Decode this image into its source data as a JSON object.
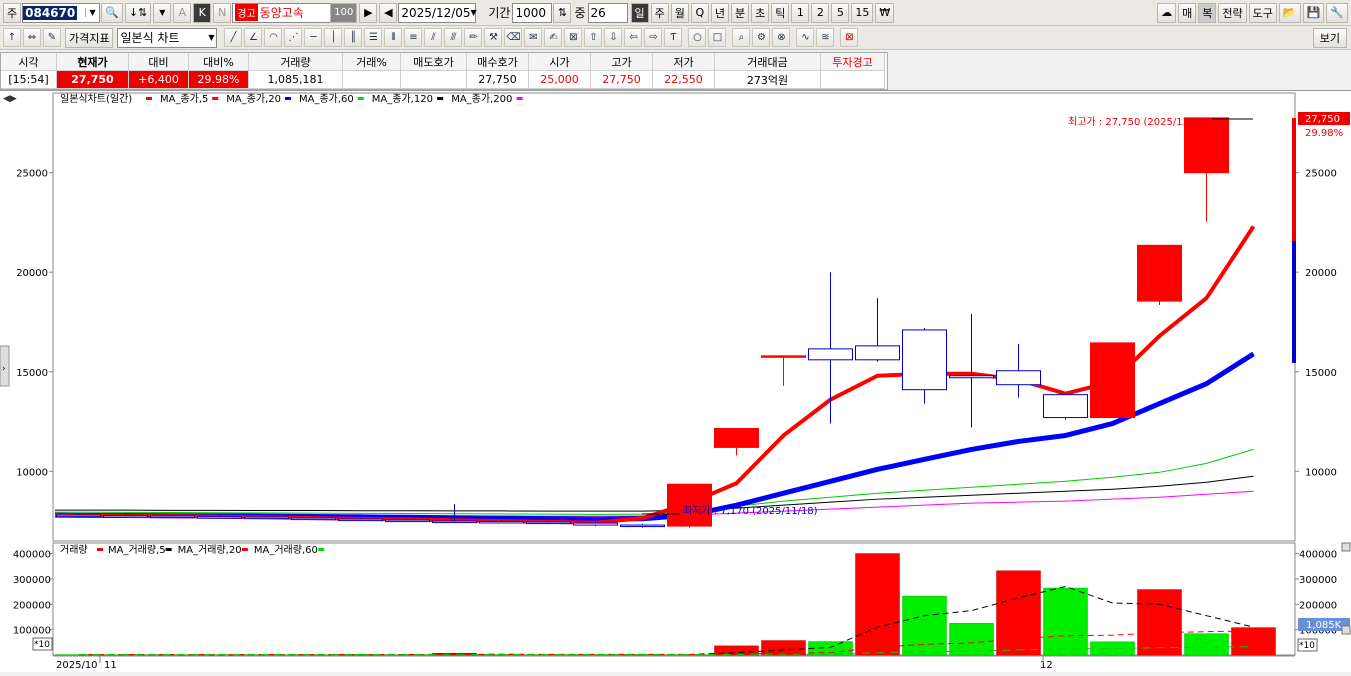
{
  "toolbar1": {
    "market": "주",
    "code": "084670",
    "warning_badge": "경고",
    "stock_name": "동양고속",
    "zoom": "100",
    "date": "2025/12/05",
    "period_label": "기간",
    "period_value": "1000",
    "count_label": "중",
    "count_value": "26",
    "intervals": [
      "일",
      "주",
      "월",
      "Q",
      "년",
      "분",
      "초",
      "틱",
      "1",
      "2",
      "5",
      "15",
      "₩"
    ],
    "right_buttons": [
      "매",
      "복",
      "전략",
      "도구"
    ]
  },
  "toolbar2": {
    "indicator_button": "가격지표",
    "chart_type": "일본식 차트",
    "view_button": "보기"
  },
  "quote": {
    "headers": [
      "시각",
      "현재가",
      "대비",
      "대비%",
      "거래량",
      "거래%",
      "매도호가",
      "매수호가",
      "시가",
      "고가",
      "저가",
      "거래대금",
      "투자경고"
    ],
    "values": [
      "[15:54]",
      "27,750",
      "+6,400",
      "29.98%",
      "1,085,181",
      "",
      "",
      "27,750",
      "25,000",
      "27,750",
      "22,550",
      "273억원",
      ""
    ]
  },
  "price_panel": {
    "legend_title": "일본식차트(일간)",
    "legend_items": [
      "MA_종가,5",
      "MA_종가,20",
      "MA_종가,60",
      "MA_종가,120",
      "MA_종가,200"
    ],
    "legend_colors": [
      "#ff0000",
      "#ff0000",
      "#0000ff",
      "#00dd00",
      "#000000",
      "#ff00ff"
    ],
    "high_annotation": "최고가 : 27,750 (2025/12/05)",
    "low_annotation": "최저가 : 7,170 (2025/11/18)",
    "last_price_tag": "27,750",
    "last_pct_tag": "29.98%"
  },
  "volume_panel": {
    "legend_title": "거래량",
    "legend_items": [
      "MA_거래량,5",
      "MA_거래량,20",
      "MA_거래량,60"
    ],
    "legend_colors": [
      "#ff0000",
      "#000000",
      "#ff0000",
      "#00dd00"
    ],
    "last_volume_tag": "1,085K",
    "scale_tag": "*10"
  },
  "x_axis": {
    "labels": [
      "2025/10",
      "11",
      "12"
    ]
  },
  "chart_data": [
    {
      "type": "candlestick",
      "title": "일본식차트(일간)",
      "ylim": [
        6500,
        29000
      ],
      "y_ticks": [
        10000,
        15000,
        20000,
        25000
      ],
      "candles": [
        {
          "o": 7800,
          "h": 7850,
          "l": 7750,
          "c": 7800,
          "up": false
        },
        {
          "o": 7780,
          "h": 7850,
          "l": 7700,
          "c": 7750,
          "up": false
        },
        {
          "o": 7750,
          "h": 7800,
          "l": 7700,
          "c": 7720,
          "up": false
        },
        {
          "o": 7720,
          "h": 7800,
          "l": 7650,
          "c": 7700,
          "up": false
        },
        {
          "o": 7700,
          "h": 7750,
          "l": 7620,
          "c": 7650,
          "up": false
        },
        {
          "o": 7650,
          "h": 7700,
          "l": 7580,
          "c": 7600,
          "up": false
        },
        {
          "o": 7600,
          "h": 7650,
          "l": 7520,
          "c": 7550,
          "up": false
        },
        {
          "o": 7550,
          "h": 7600,
          "l": 7480,
          "c": 7500,
          "up": false
        },
        {
          "o": 7500,
          "h": 8350,
          "l": 7450,
          "c": 7480,
          "up": false
        },
        {
          "o": 7480,
          "h": 7550,
          "l": 7400,
          "c": 7450,
          "up": false
        },
        {
          "o": 7450,
          "h": 7500,
          "l": 7350,
          "c": 7400,
          "up": false
        },
        {
          "o": 7400,
          "h": 7450,
          "l": 7250,
          "c": 7300,
          "up": false
        },
        {
          "o": 7300,
          "h": 7350,
          "l": 7170,
          "c": 7250,
          "up": false
        },
        {
          "o": 7250,
          "h": 9350,
          "l": 7170,
          "c": 9350,
          "up": true
        },
        {
          "o": 11200,
          "h": 12150,
          "l": 10800,
          "c": 12150,
          "up": true
        },
        {
          "o": 15750,
          "h": 15800,
          "l": 14300,
          "c": 15800,
          "up": true
        },
        {
          "o": 16150,
          "h": 20000,
          "l": 12400,
          "c": 15600,
          "up": false
        },
        {
          "o": 16300,
          "h": 18700,
          "l": 15500,
          "c": 15600,
          "up": false
        },
        {
          "o": 17100,
          "h": 17200,
          "l": 13400,
          "c": 14100,
          "up": false
        },
        {
          "o": 14800,
          "h": 17900,
          "l": 12200,
          "c": 14700,
          "up": false
        },
        {
          "o": 15050,
          "h": 16400,
          "l": 13700,
          "c": 14350,
          "up": false
        },
        {
          "o": 13850,
          "h": 13850,
          "l": 12600,
          "c": 12700,
          "up": false
        },
        {
          "o": 12700,
          "h": 16450,
          "l": 12700,
          "c": 16450,
          "up": true
        },
        {
          "o": 18550,
          "h": 21350,
          "l": 18350,
          "c": 21350,
          "up": true
        },
        {
          "o": 25000,
          "h": 27750,
          "l": 22550,
          "c": 27750,
          "up": true
        }
      ],
      "series": [
        {
          "name": "MA_종가,5",
          "color": "#ff0000",
          "values": [
            7800,
            7780,
            7760,
            7740,
            7720,
            7690,
            7650,
            7610,
            7580,
            7540,
            7500,
            7460,
            7420,
            7650,
            8400,
            9400,
            11800,
            13600,
            14800,
            14900,
            14900,
            14600,
            13900,
            14500,
            16800,
            18700,
            22300
          ]
        },
        {
          "name": "MA_종가,20",
          "color": "#0000ff",
          "values": [
            7800,
            7790,
            7780,
            7770,
            7760,
            7750,
            7730,
            7710,
            7690,
            7670,
            7650,
            7620,
            7600,
            7620,
            7800,
            8300,
            8900,
            9500,
            10100,
            10600,
            11100,
            11500,
            11800,
            12400,
            13400,
            14400,
            15900
          ]
        },
        {
          "name": "MA_종가,60",
          "color": "#00cc00",
          "values": [
            7950,
            7950,
            7940,
            7930,
            7920,
            7910,
            7900,
            7890,
            7880,
            7870,
            7860,
            7850,
            7840,
            7850,
            8000,
            8250,
            8500,
            8700,
            8900,
            9050,
            9200,
            9350,
            9500,
            9700,
            9950,
            10400,
            11100
          ]
        },
        {
          "name": "MA_종가,120",
          "color": "#000000",
          "values": [
            8050,
            8050,
            8050,
            8040,
            8040,
            8030,
            8030,
            8020,
            8020,
            8010,
            8010,
            8000,
            8000,
            8000,
            8050,
            8150,
            8300,
            8450,
            8600,
            8700,
            8800,
            8900,
            9000,
            9100,
            9250,
            9450,
            9750
          ]
        },
        {
          "name": "MA_종가,200",
          "color": "#ff00ff",
          "values": [
            7750,
            7750,
            7750,
            7750,
            7750,
            7750,
            7750,
            7750,
            7750,
            7750,
            7750,
            7750,
            7750,
            7760,
            7800,
            7900,
            8000,
            8100,
            8200,
            8300,
            8400,
            8450,
            8500,
            8600,
            8700,
            8850,
            9000
          ]
        }
      ]
    },
    {
      "type": "bar",
      "title": "거래량",
      "ylim": [
        0,
        410000
      ],
      "y_ticks": [
        100000,
        200000,
        300000,
        400000
      ],
      "values": [
        1500,
        1200,
        1300,
        1000,
        1200,
        1400,
        2500,
        1500,
        7000,
        2000,
        1500,
        2000,
        2500,
        1800,
        36000,
        57000,
        53000,
        400000,
        232000,
        125000,
        332000,
        264000,
        52000,
        258000,
        84000,
        108000
      ],
      "up": [
        false,
        false,
        false,
        false,
        false,
        false,
        false,
        false,
        true,
        false,
        false,
        false,
        false,
        false,
        true,
        true,
        false,
        true,
        false,
        false,
        true,
        false,
        false,
        true,
        false,
        true
      ],
      "series": [
        {
          "name": "MA_거래량,5",
          "color": "#000000",
          "values": [
            1500,
            1400,
            1300,
            1200,
            1300,
            1300,
            1500,
            2000,
            2500,
            2800,
            2600,
            2600,
            2500,
            2200,
            9000,
            20000,
            30000,
            110000,
            155000,
            175000,
            225000,
            270000,
            205000,
            200000,
            155000,
            110000
          ]
        },
        {
          "name": "MA_거래량,20",
          "color": "#ff0000",
          "values": [
            1500,
            1500,
            1500,
            1500,
            1500,
            1500,
            1500,
            1500,
            1600,
            1700,
            1800,
            1800,
            1900,
            2000,
            4000,
            7000,
            9500,
            30000,
            42000,
            48000,
            64000,
            76000,
            78000,
            88000,
            92000,
            95000
          ]
        },
        {
          "name": "MA_거래량,60",
          "color": "#00cc00",
          "values": [
            1500,
            1500,
            1500,
            1500,
            1500,
            1500,
            1500,
            1500,
            1500,
            1500,
            1500,
            1500,
            1500,
            1500,
            2000,
            3000,
            4000,
            9000,
            13000,
            15000,
            20000,
            24000,
            25000,
            29000,
            31000,
            33000
          ]
        }
      ]
    }
  ]
}
